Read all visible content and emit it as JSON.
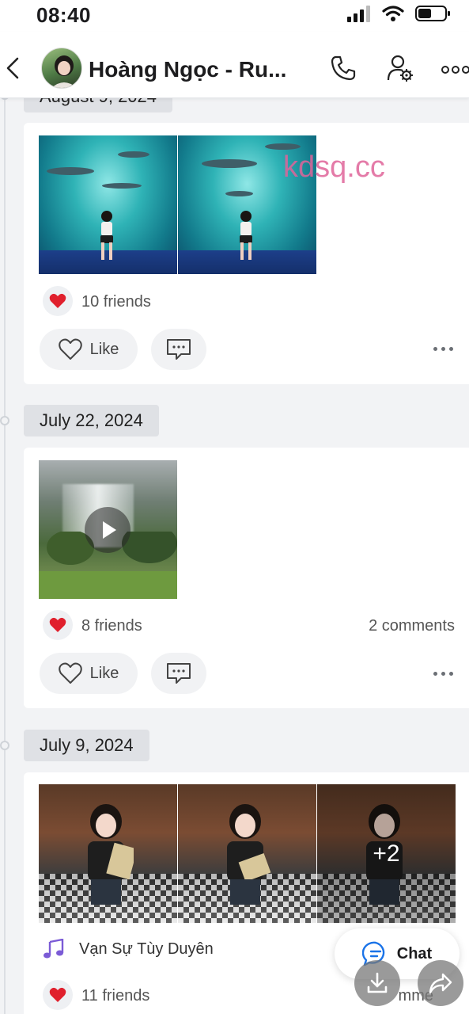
{
  "status": {
    "time": "08:40"
  },
  "header": {
    "title": "Hoàng Ngọc - Ru..."
  },
  "watermark": "kdsq.cc",
  "posts": [
    {
      "date": "August 9, 2024",
      "reactions": "10 friends",
      "like_label": "Like"
    },
    {
      "date": "July 22, 2024",
      "reactions": "8 friends",
      "comments": "2 comments",
      "like_label": "Like"
    },
    {
      "date": "July 9, 2024",
      "extra_photos": "+2",
      "music": "Vạn Sự Tùy Duyên",
      "reactions": "11 friends",
      "comments_partial": "mme"
    }
  ],
  "fab": {
    "chat_label": "Chat"
  }
}
